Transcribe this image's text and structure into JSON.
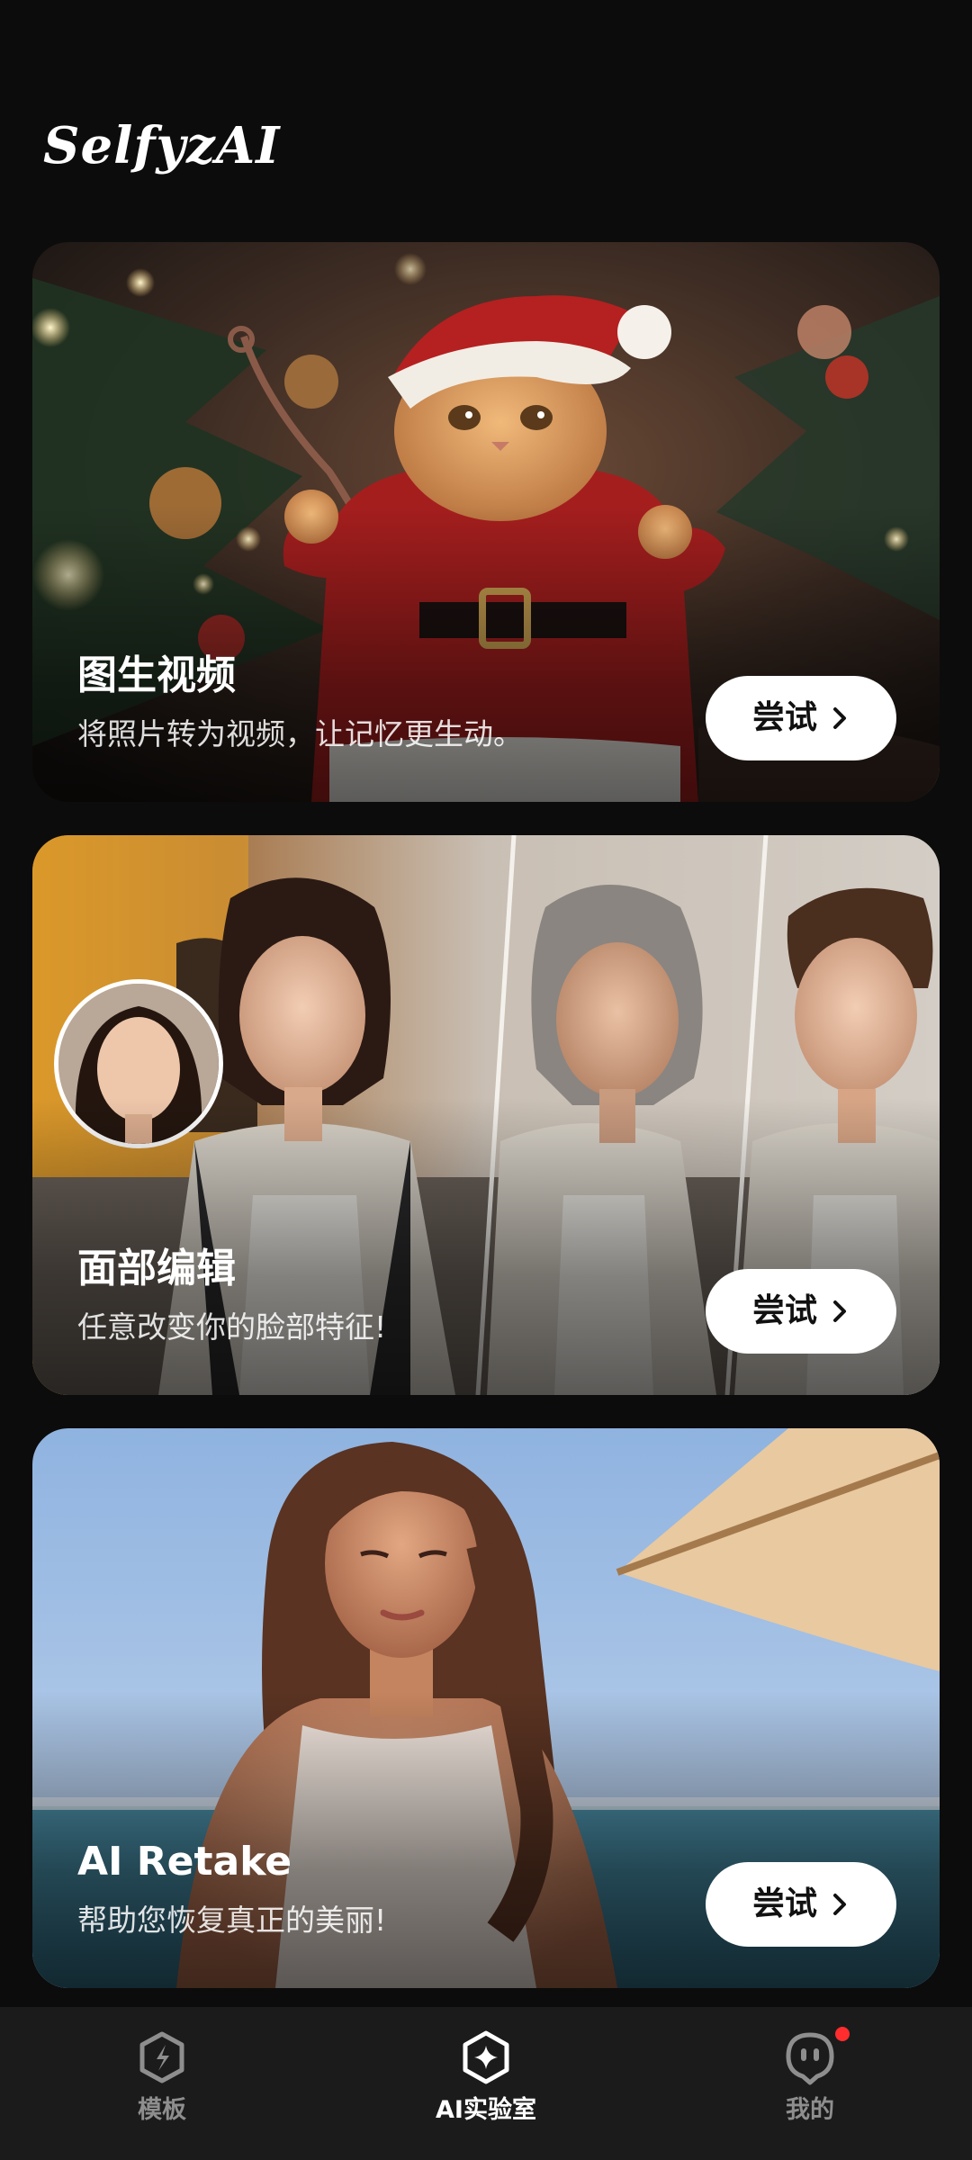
{
  "header": {
    "logo_text": "SelfyzAI"
  },
  "cards": [
    {
      "title": "图生视频",
      "subtitle": "将照片转为视频，让记忆更生动。",
      "button_label": "尝试",
      "button_icon": "chevron-right-icon"
    },
    {
      "title": "面部编辑",
      "subtitle": "任意改变你的脸部特征!",
      "button_label": "尝试",
      "button_icon": "chevron-right-icon"
    },
    {
      "title": "AI Retake",
      "subtitle": "帮助您恢复真正的美丽!",
      "button_label": "尝试",
      "button_icon": "chevron-right-icon"
    }
  ],
  "bottom_nav": {
    "items": [
      {
        "label": "模板",
        "icon": "template-bolt-icon",
        "active": false
      },
      {
        "label": "AI实验室",
        "icon": "ai-lab-sparkle-icon",
        "active": true
      },
      {
        "label": "我的",
        "icon": "profile-face-icon",
        "active": false,
        "has_notification": true
      }
    ]
  },
  "colors": {
    "background": "#0c0c0c",
    "nav_background": "#1b1b1b",
    "button_background": "#ffffff",
    "nav_active": "#ffffff",
    "nav_inactive": "#8e8e8e",
    "notification_dot": "#ff2d2d"
  }
}
